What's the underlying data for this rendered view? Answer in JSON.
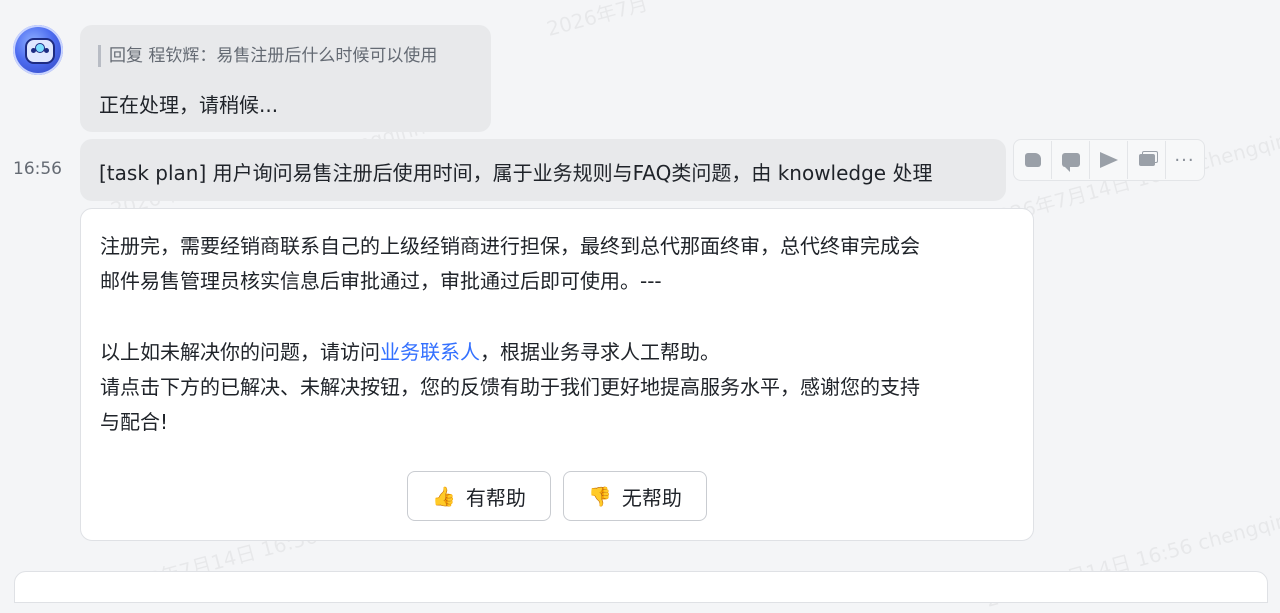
{
  "watermark": "2026年7月14日 16:56 chengqinhui",
  "watermark_top": "2026年7月",
  "reply_bubble": {
    "quote": "回复 程钦辉：易售注册后什么时候可以使用",
    "text": "正在处理，请稍候..."
  },
  "message": {
    "time": "16:56",
    "task_plan": "[task plan] 用户询问易售注册后使用时间，属于业务规则与FAQ类问题，由 knowledge 处理"
  },
  "toolbar": {
    "icons": [
      "thumbs-up-icon",
      "comment-icon",
      "forward-icon",
      "copy-icon",
      "more-icon"
    ],
    "more_label": "···"
  },
  "answer": {
    "line1": "注册完，需要经销商联系自己的上级经销商进行担保，最终到总代那面终审，总代终审完成会",
    "line2": "邮件易售管理员核实信息后审批通过，审批通过后即可使用。---",
    "line3_prefix": "以上如未解决你的问题，请访问",
    "line3_link": "业务联系人",
    "line3_suffix": "，根据业务寻求人工帮助。",
    "line4": "请点击下方的已解决、未解决按钮，您的反馈有助于我们更好地提高服务水平，感谢您的支持",
    "line5": "与配合!"
  },
  "feedback": {
    "helpful_icon": "👍",
    "helpful_label": "有帮助",
    "unhelpful_icon": "👎",
    "unhelpful_label": "无帮助"
  },
  "colors": {
    "link": "#3370ff",
    "bubble": "#e8e9eb",
    "background": "#f4f5f7"
  }
}
